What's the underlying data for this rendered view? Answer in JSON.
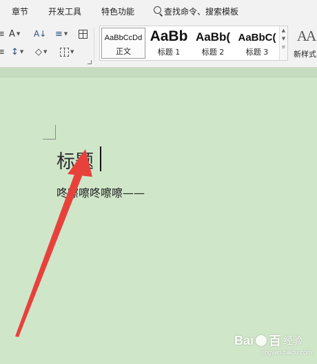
{
  "menu": {
    "items": [
      {
        "label": "章节"
      },
      {
        "label": "开发工具"
      },
      {
        "label": "特色功能"
      }
    ],
    "search_label": "查找命令、搜索模板"
  },
  "ribbon": {
    "font_tools": {
      "change_case_glyph": "A",
      "sort_glyph": "A↓",
      "line_spacing_glyph": "≡",
      "shading_glyph": "◇"
    },
    "style_gallery": [
      {
        "sample": "AaBbCcDd",
        "label": "正文"
      },
      {
        "sample": "AaBb",
        "label": "标题 1"
      },
      {
        "sample": "AaBb(",
        "label": "标题 2"
      },
      {
        "sample": "AaBbC(",
        "label": "标题 3"
      }
    ],
    "new_style": {
      "glyph": "AA",
      "label": "新样式"
    }
  },
  "document": {
    "heading": "标题",
    "body": "咚嚓嚓咚嚓嚓——"
  },
  "watermark": {
    "brand": "Bai",
    "brand_end": "百",
    "sub": "经验",
    "url": "jingyan.baidu.com"
  },
  "colors": {
    "page_background": "#cfe6c9",
    "ribbon_background": "#f2f2f2",
    "arrow": "#e8413c"
  }
}
